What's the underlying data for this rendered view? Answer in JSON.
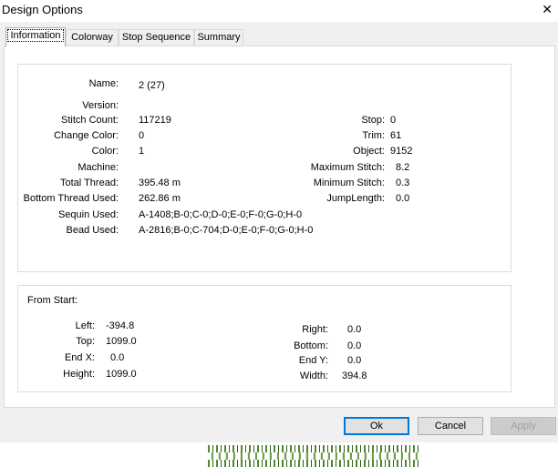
{
  "window": {
    "title": "Design Options",
    "close_glyph": "✕"
  },
  "tabs": [
    "Information",
    "Colorway",
    "Stop Sequence",
    "Summary"
  ],
  "info": {
    "name": {
      "label": "Name:",
      "value": "2 (27)"
    },
    "version": {
      "label": "Version:",
      "value": ""
    },
    "stitch_count": {
      "label": "Stitch Count:",
      "value": "117219"
    },
    "change_color": {
      "label": "Change Color:",
      "value": "0"
    },
    "color": {
      "label": "Color:",
      "value": "1"
    },
    "machine": {
      "label": "Machine:",
      "value": ""
    },
    "total_thread": {
      "label": "Total Thread:",
      "value": "395.48 m"
    },
    "bottom_thread": {
      "label": "Bottom Thread Used:",
      "value": "262.86 m"
    },
    "sequin_used": {
      "label": "Sequin Used:",
      "value": "A-1408;B-0;C-0;D-0;E-0;F-0;G-0;H-0"
    },
    "bead_used": {
      "label": "Bead Used:",
      "value": "A-2816;B-0;C-704;D-0;E-0;F-0;G-0;H-0"
    },
    "stop": {
      "label": "Stop:",
      "value": "0"
    },
    "trim": {
      "label": "Trim:",
      "value": "61"
    },
    "object": {
      "label": "Object:",
      "value": "9152"
    },
    "max_stitch": {
      "label": "Maximum Stitch:",
      "value": "8.2"
    },
    "min_stitch": {
      "label": "Minimum Stitch:",
      "value": "0.3"
    },
    "jump_length": {
      "label": "JumpLength:",
      "value": "0.0"
    }
  },
  "from_start": {
    "heading": "From Start:",
    "left": {
      "label": "Left:",
      "value": "-394.8"
    },
    "top": {
      "label": "Top:",
      "value": "1099.0"
    },
    "end_x": {
      "label": "End X:",
      "value": "0.0"
    },
    "height": {
      "label": "Height:",
      "value": "1099.0"
    },
    "right": {
      "label": "Right:",
      "value": "0.0"
    },
    "bottom": {
      "label": "Bottom:",
      "value": "0.0"
    },
    "end_y": {
      "label": "End Y:",
      "value": "0.0"
    },
    "width": {
      "label": "Width:",
      "value": "394.8"
    }
  },
  "buttons": {
    "ok": "Ok",
    "cancel": "Cancel",
    "apply": "Apply"
  },
  "colors": {
    "dialog_bg": "#f0f0f0",
    "accent": "#0078d7",
    "disabled_text": "#a0a0a0"
  }
}
